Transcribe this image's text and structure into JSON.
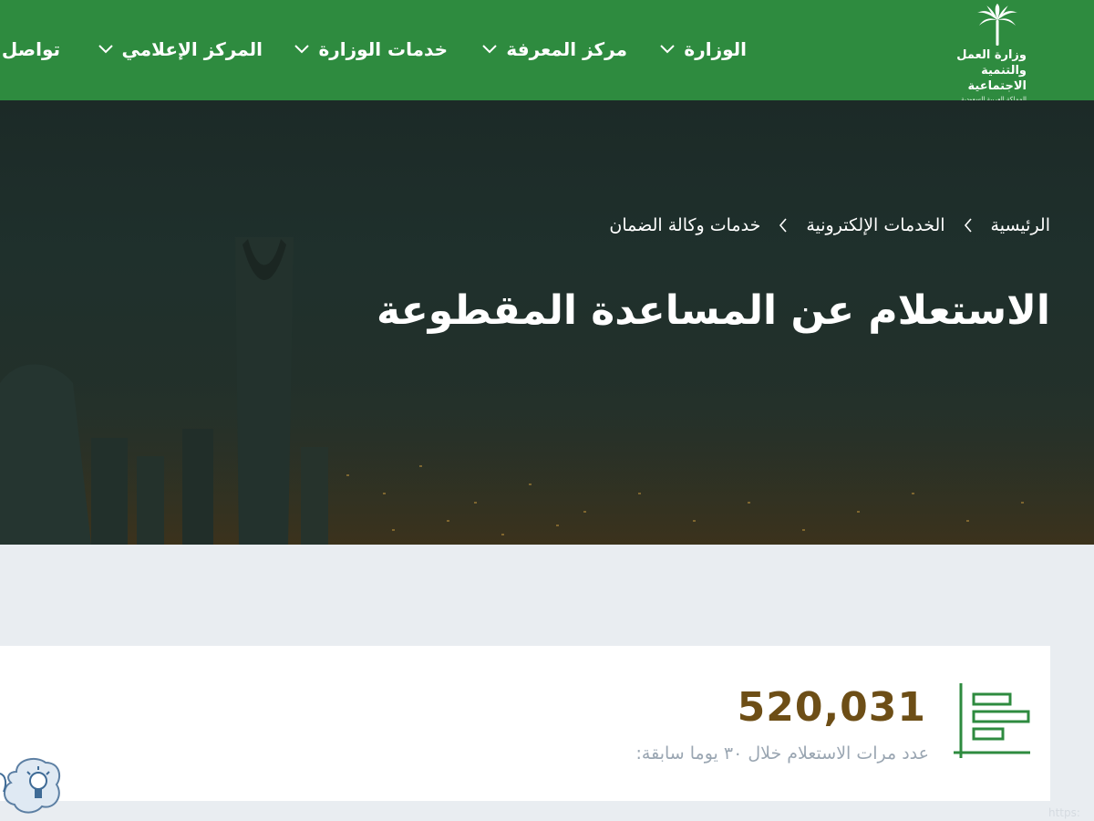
{
  "logo": {
    "line1": "وزارة العمل",
    "line2": "والتنمية الاجتماعية",
    "line3": "المملكة العربية السعودية"
  },
  "nav": {
    "items": [
      {
        "label": "الوزارة",
        "has_dropdown": true
      },
      {
        "label": "مركز المعرفة",
        "has_dropdown": true
      },
      {
        "label": "خدمات الوزارة",
        "has_dropdown": true
      },
      {
        "label": "المركز الإعلامي",
        "has_dropdown": true
      },
      {
        "label": "تواصل",
        "has_dropdown": false
      }
    ]
  },
  "breadcrumb": {
    "items": [
      "الرئيسية",
      "الخدمات الإلكترونية",
      "خدمات وكالة الضمان"
    ]
  },
  "hero": {
    "title": "الاستعلام عن المساعدة المقطوعة"
  },
  "stat": {
    "value": "520,031",
    "label": "عدد مرات الاستعلام خلال ٣٠ يوما سابقة:",
    "icon": "bar-chart-icon"
  },
  "help": {
    "icon": "lightbulb-help-icon"
  },
  "url_hint": "https:",
  "colors": {
    "nav_bg": "#2e8b3f",
    "stat_value": "#6d4e16",
    "stat_icon": "#2e8b3f",
    "label_gray": "#9aa6b2"
  }
}
